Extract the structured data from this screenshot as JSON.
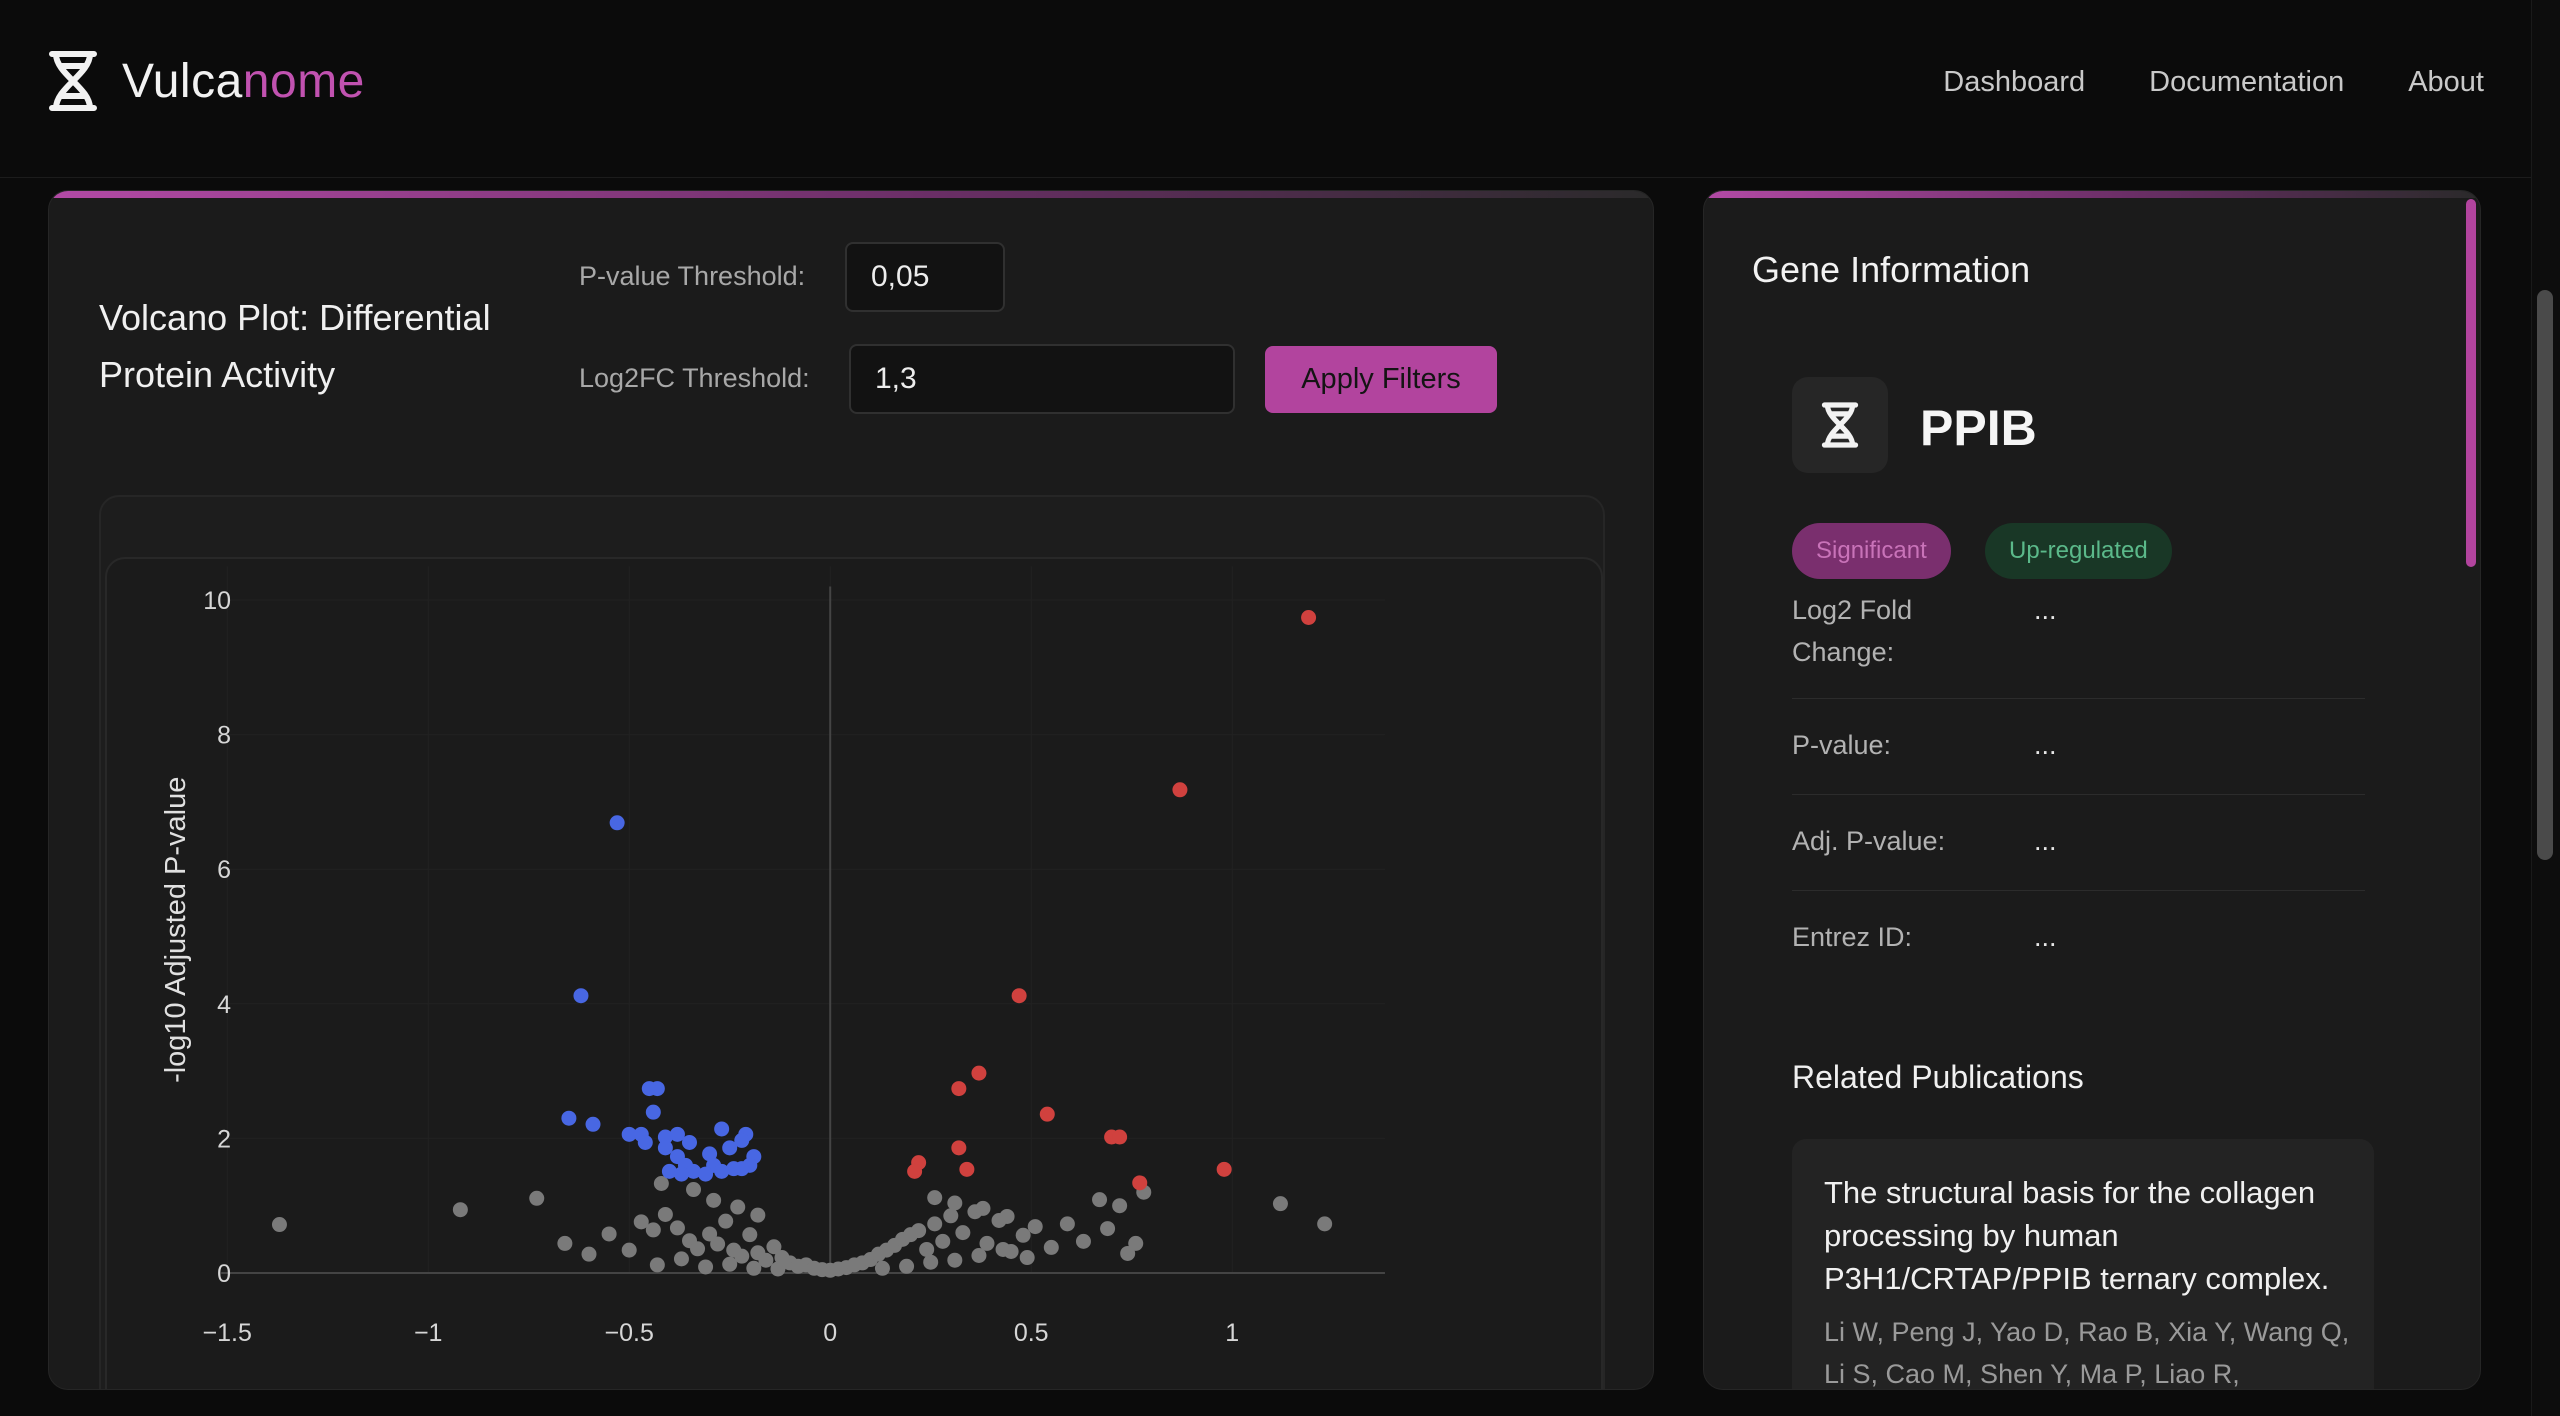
{
  "app": {
    "brand_prefix": "Vulca",
    "brand_suffix": "nome",
    "nav": [
      "Dashboard",
      "Documentation",
      "About"
    ],
    "colors": {
      "accent": "#b2449e",
      "up": "#d0413e",
      "down": "#4867e3",
      "ns": "#7a7a7a"
    }
  },
  "plot_panel": {
    "title": "Volcano Plot: Differential Protein Activity",
    "pvalue_label": "P-value Threshold:",
    "pvalue_value": "0,05",
    "log2fc_label": "Log2FC Threshold:",
    "log2fc_value": "1,3",
    "apply_label": "Apply Filters"
  },
  "chart_data": {
    "type": "scatter",
    "title": "",
    "xlabel": "",
    "ylabel": "-log10 Adjusted P-value",
    "xlim": [
      -1.6,
      1.4
    ],
    "ylim": [
      0,
      10.4
    ],
    "xticks": [
      -1.5,
      -1,
      -0.5,
      0,
      0.5,
      1
    ],
    "xtick_labels": [
      "−1.5",
      "−1",
      "−0.5",
      "0",
      "0.5",
      "1"
    ],
    "yticks": [
      0,
      2,
      4,
      6,
      8,
      10
    ],
    "ytick_labels": [
      "0",
      "2",
      "4",
      "6",
      "8",
      "10"
    ],
    "zero_line": true,
    "series": [
      {
        "color": "#d0413e",
        "points": [
          [
            1.19,
            9.74
          ],
          [
            0.87,
            7.18
          ],
          [
            0.47,
            4.12
          ],
          [
            0.37,
            2.97
          ],
          [
            0.32,
            2.74
          ],
          [
            0.54,
            2.36
          ],
          [
            0.7,
            2.02
          ],
          [
            0.72,
            2.02
          ],
          [
            0.32,
            1.86
          ],
          [
            0.98,
            1.54
          ],
          [
            0.34,
            1.54
          ],
          [
            0.22,
            1.64
          ],
          [
            0.21,
            1.51
          ],
          [
            0.77,
            1.34
          ]
        ]
      },
      {
        "color": "#4867e3",
        "points": [
          [
            -0.53,
            6.69
          ],
          [
            -0.62,
            4.12
          ],
          [
            -0.45,
            2.74
          ],
          [
            -0.43,
            2.74
          ],
          [
            -0.44,
            2.39
          ],
          [
            -0.65,
            2.3
          ],
          [
            -0.59,
            2.21
          ],
          [
            -0.5,
            2.06
          ],
          [
            -0.47,
            2.06
          ],
          [
            -0.41,
            2.02
          ],
          [
            -0.38,
            2.06
          ],
          [
            -0.27,
            2.14
          ],
          [
            -0.21,
            2.06
          ],
          [
            -0.22,
            1.97
          ],
          [
            -0.46,
            1.94
          ],
          [
            -0.35,
            1.94
          ],
          [
            -0.25,
            1.86
          ],
          [
            -0.41,
            1.86
          ],
          [
            -0.3,
            1.77
          ],
          [
            -0.38,
            1.73
          ],
          [
            -0.19,
            1.73
          ],
          [
            -0.2,
            1.6
          ],
          [
            -0.36,
            1.6
          ],
          [
            -0.29,
            1.6
          ],
          [
            -0.24,
            1.55
          ],
          [
            -0.4,
            1.51
          ],
          [
            -0.34,
            1.51
          ],
          [
            -0.27,
            1.51
          ],
          [
            -0.22,
            1.55
          ],
          [
            -0.31,
            1.47
          ],
          [
            -0.37,
            1.47
          ]
        ]
      },
      {
        "color": "#7a7a7a",
        "points": [
          [
            -1.37,
            0.72
          ],
          [
            -0.92,
            0.94
          ],
          [
            -0.73,
            1.11
          ],
          [
            -0.66,
            0.44
          ],
          [
            -0.55,
            0.58
          ],
          [
            -0.6,
            0.28
          ],
          [
            -0.47,
            0.76
          ],
          [
            -0.44,
            0.64
          ],
          [
            -0.41,
            0.87
          ],
          [
            -0.38,
            0.67
          ],
          [
            -0.35,
            0.48
          ],
          [
            -0.33,
            0.36
          ],
          [
            -0.3,
            0.58
          ],
          [
            -0.28,
            0.43
          ],
          [
            -0.26,
            0.77
          ],
          [
            -0.24,
            0.34
          ],
          [
            -0.22,
            0.25
          ],
          [
            -0.2,
            0.57
          ],
          [
            -0.18,
            0.3
          ],
          [
            -0.16,
            0.19
          ],
          [
            -0.14,
            0.39
          ],
          [
            -0.12,
            0.23
          ],
          [
            -0.1,
            0.15
          ],
          [
            -0.08,
            0.1
          ],
          [
            -0.06,
            0.12
          ],
          [
            -0.04,
            0.07
          ],
          [
            -0.02,
            0.05
          ],
          [
            0.0,
            0.04
          ],
          [
            0.02,
            0.06
          ],
          [
            0.04,
            0.08
          ],
          [
            0.06,
            0.12
          ],
          [
            0.08,
            0.15
          ],
          [
            0.1,
            0.2
          ],
          [
            0.12,
            0.28
          ],
          [
            0.14,
            0.34
          ],
          [
            0.16,
            0.41
          ],
          [
            0.18,
            0.5
          ],
          [
            0.2,
            0.57
          ],
          [
            0.22,
            0.63
          ],
          [
            0.24,
            0.35
          ],
          [
            0.26,
            0.73
          ],
          [
            0.28,
            0.47
          ],
          [
            0.3,
            0.85
          ],
          [
            0.33,
            0.6
          ],
          [
            0.36,
            0.91
          ],
          [
            0.39,
            0.44
          ],
          [
            0.42,
            0.78
          ],
          [
            0.45,
            0.32
          ],
          [
            0.48,
            0.56
          ],
          [
            0.51,
            0.69
          ],
          [
            0.55,
            0.38
          ],
          [
            0.59,
            0.73
          ],
          [
            0.63,
            0.47
          ],
          [
            0.67,
            1.09
          ],
          [
            0.69,
            0.66
          ],
          [
            0.72,
            1.0
          ],
          [
            0.76,
            0.44
          ],
          [
            0.78,
            1.2
          ],
          [
            1.12,
            1.03
          ],
          [
            1.23,
            0.73
          ],
          [
            -0.5,
            0.34
          ],
          [
            -0.43,
            0.12
          ],
          [
            -0.37,
            0.21
          ],
          [
            -0.31,
            0.09
          ],
          [
            -0.25,
            0.13
          ],
          [
            -0.19,
            0.07
          ],
          [
            -0.13,
            0.06
          ],
          [
            0.13,
            0.07
          ],
          [
            0.19,
            0.1
          ],
          [
            0.25,
            0.16
          ],
          [
            0.31,
            0.19
          ],
          [
            0.37,
            0.26
          ],
          [
            0.43,
            0.35
          ],
          [
            0.49,
            0.23
          ],
          [
            -0.34,
            1.24
          ],
          [
            -0.29,
            1.08
          ],
          [
            -0.23,
            0.98
          ],
          [
            -0.18,
            0.86
          ],
          [
            0.26,
            1.12
          ],
          [
            0.31,
            1.04
          ],
          [
            0.38,
            0.96
          ],
          [
            0.44,
            0.84
          ],
          [
            -0.42,
            1.33
          ],
          [
            0.74,
            0.29
          ]
        ]
      }
    ]
  },
  "gene_panel": {
    "heading": "Gene Information",
    "symbol": "PPIB",
    "badge_significant": "Significant",
    "badge_regulation": "Up-regulated",
    "rows": [
      {
        "label": "Log2 Fold Change:",
        "value": "..."
      },
      {
        "label": "P-value:",
        "value": "..."
      },
      {
        "label": "Adj. P-value:",
        "value": "..."
      },
      {
        "label": "Entrez ID:",
        "value": "..."
      }
    ],
    "publications_heading": "Related Publications",
    "publication": {
      "title": "The structural basis for the collagen processing by human P3H1/CRTAP/PPIB ternary complex.",
      "authors": "Li W, Peng J, Yao D, Rao B, Xia Y, Wang Q, Li S, Cao M, Shen Y, Ma P, Liao R,"
    }
  }
}
